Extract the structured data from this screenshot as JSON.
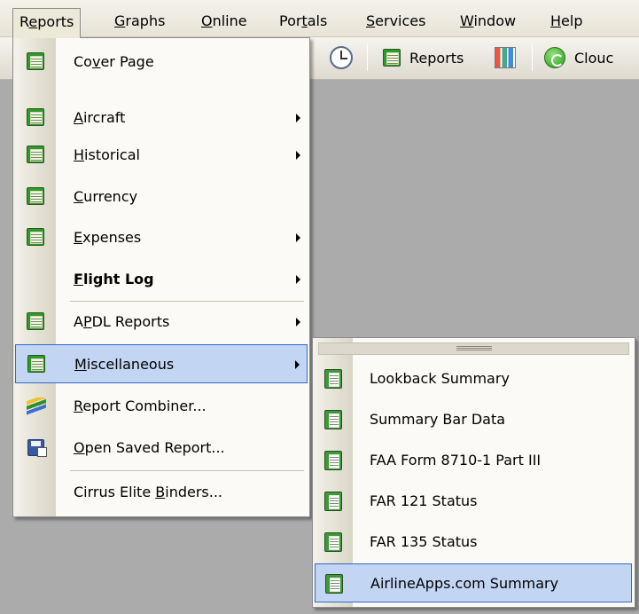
{
  "menubar": {
    "items": [
      {
        "label": "Reports",
        "u": 1
      },
      {
        "label": "Graphs",
        "u": 0
      },
      {
        "label": "Online",
        "u": 0
      },
      {
        "label": "Portals",
        "u": 3
      },
      {
        "label": "Services",
        "u": 0
      },
      {
        "label": "Window",
        "u": 0
      },
      {
        "label": "Help",
        "u": 0
      }
    ]
  },
  "toolbar": {
    "reports_label": "Reports",
    "cloud_label": "Clouc"
  },
  "menu": {
    "items": [
      {
        "label": "Cover Page",
        "u": 2,
        "icon": "report-icon",
        "arrow": false
      },
      {
        "label": "Aircraft",
        "u": 0,
        "icon": "report-icon",
        "arrow": true
      },
      {
        "label": "Historical",
        "u": 0,
        "icon": "report-icon",
        "arrow": true
      },
      {
        "label": "Currency",
        "u": 0,
        "icon": "report-icon",
        "arrow": false
      },
      {
        "label": "Expenses",
        "u": 0,
        "icon": "report-icon",
        "arrow": true
      },
      {
        "label": "Flight Log",
        "u": 0,
        "icon": "",
        "arrow": true
      },
      {
        "label": "APDL Reports",
        "u": 1,
        "icon": "report-icon",
        "arrow": true
      },
      {
        "label": "Miscellaneous",
        "u": 0,
        "icon": "report-icon",
        "arrow": true
      },
      {
        "label": "Report Combiner...",
        "u": 0,
        "icon": "combiner-icon",
        "arrow": false
      },
      {
        "label": "Open Saved Report...",
        "u": 0,
        "icon": "floppy-icon",
        "arrow": false
      },
      {
        "label": "Cirrus Elite Binders...",
        "u": 13,
        "icon": "",
        "arrow": false
      }
    ]
  },
  "submenu": {
    "items": [
      {
        "label": "Lookback Summary"
      },
      {
        "label": "Summary Bar Data"
      },
      {
        "label": "FAA Form 8710-1 Part III"
      },
      {
        "label": "FAR 121 Status"
      },
      {
        "label": "FAR 135 Status"
      },
      {
        "label": "AirlineApps.com Summary"
      }
    ]
  }
}
